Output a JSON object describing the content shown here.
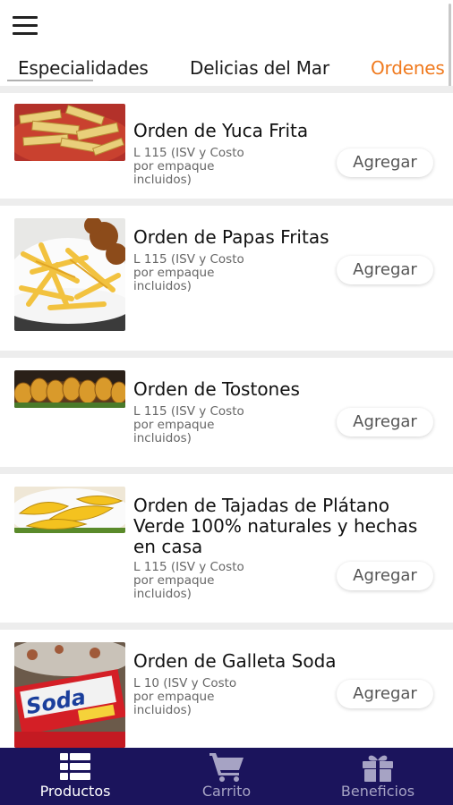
{
  "header": {
    "menu_icon": "hamburger-menu-icon"
  },
  "tabs": [
    {
      "label": "Especialidades"
    },
    {
      "label": "Delicias del Mar"
    },
    {
      "label": "Ordenes"
    }
  ],
  "colors": {
    "accent": "#f07a1e",
    "nav_bg": "#1b145c",
    "nav_active": "#ffffff",
    "nav_inactive": "#a6a3c4"
  },
  "products": [
    {
      "title": "Orden de Yuca Frita",
      "desc": "L 115 (ISV y Costo por empaque incluidos)",
      "button": "Agregar"
    },
    {
      "title": "Orden de Papas Fritas",
      "desc": "L 115 (ISV y Costo por empaque incluidos)",
      "button": "Agregar"
    },
    {
      "title": "Orden de Tostones",
      "desc": "L 115 (ISV y Costo por empaque incluidos)",
      "button": "Agregar"
    },
    {
      "title": "Orden de Tajadas de Plátano Verde 100% naturales y hechas en casa",
      "desc": "L 115 (ISV y Costo por empaque incluidos)",
      "button": "Agregar"
    },
    {
      "title": "Orden de Galleta Soda",
      "desc": "L 10 (ISV y Costo por empaque incluidos)",
      "button": "Agregar"
    }
  ],
  "soda_logo": "Soda",
  "bottom_nav": [
    {
      "label": "Productos",
      "icon": "list-grid-icon",
      "active": true
    },
    {
      "label": "Carrito",
      "icon": "cart-icon",
      "active": false
    },
    {
      "label": "Beneficios",
      "icon": "gift-icon",
      "active": false
    }
  ]
}
